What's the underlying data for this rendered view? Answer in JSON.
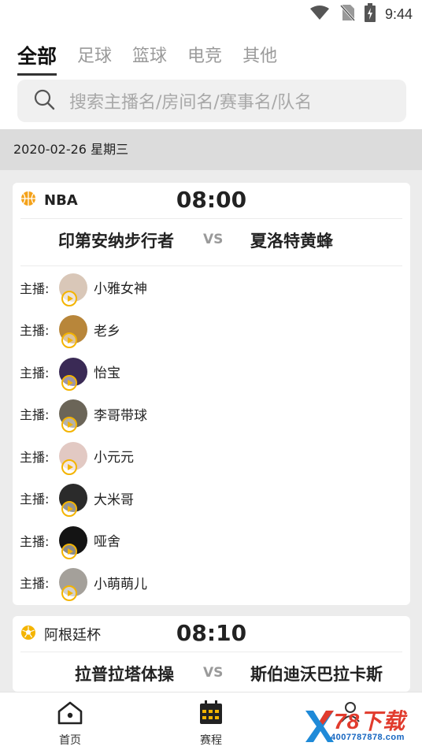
{
  "status_bar": {
    "time": "9:44",
    "icons": [
      "wifi-icon",
      "no-sim-icon",
      "battery-charging-icon"
    ]
  },
  "tabs": [
    {
      "label": "全部",
      "active": true
    },
    {
      "label": "足球",
      "active": false
    },
    {
      "label": "篮球",
      "active": false
    },
    {
      "label": "电竞",
      "active": false
    },
    {
      "label": "其他",
      "active": false
    }
  ],
  "search": {
    "placeholder": "搜索主播名/房间名/赛事名/队名",
    "icon": "search-icon"
  },
  "date_header": "2020-02-26 星期三",
  "matches": [
    {
      "league": "NBA",
      "league_icon": "basketball-icon",
      "time": "08:00",
      "home": "印第安纳步行者",
      "vs": "VS",
      "away": "夏洛特黄蜂",
      "anchor_prefix": "主播:",
      "anchors": [
        {
          "name": "小雅女神",
          "avatar_color": "#d9c7b8"
        },
        {
          "name": "老乡",
          "avatar_color": "#b8863a"
        },
        {
          "name": "怡宝",
          "avatar_color": "#3a2a55"
        },
        {
          "name": "李哥带球",
          "avatar_color": "#6b6558"
        },
        {
          "name": "小元元",
          "avatar_color": "#e2c9c3"
        },
        {
          "name": "大米哥",
          "avatar_color": "#2b2b2b"
        },
        {
          "name": "哑舍",
          "avatar_color": "#141414"
        },
        {
          "name": "小萌萌儿",
          "avatar_color": "#a4a09a"
        }
      ]
    },
    {
      "league": "阿根廷杯",
      "league_icon": "soccer-ball-icon",
      "time": "08:10",
      "home": "拉普拉塔体操",
      "vs": "VS",
      "away": "斯伯迪沃巴拉卡斯"
    }
  ],
  "bottom_nav": [
    {
      "label": "首页",
      "icon": "home-icon"
    },
    {
      "label": "赛程",
      "icon": "calendar-icon"
    },
    {
      "label": "",
      "icon": "user-icon"
    }
  ],
  "watermark": {
    "text": "78下载",
    "sub": "4007787878.com"
  },
  "colors": {
    "accent": "#f4b400",
    "watermark_red": "#e13b2d"
  }
}
